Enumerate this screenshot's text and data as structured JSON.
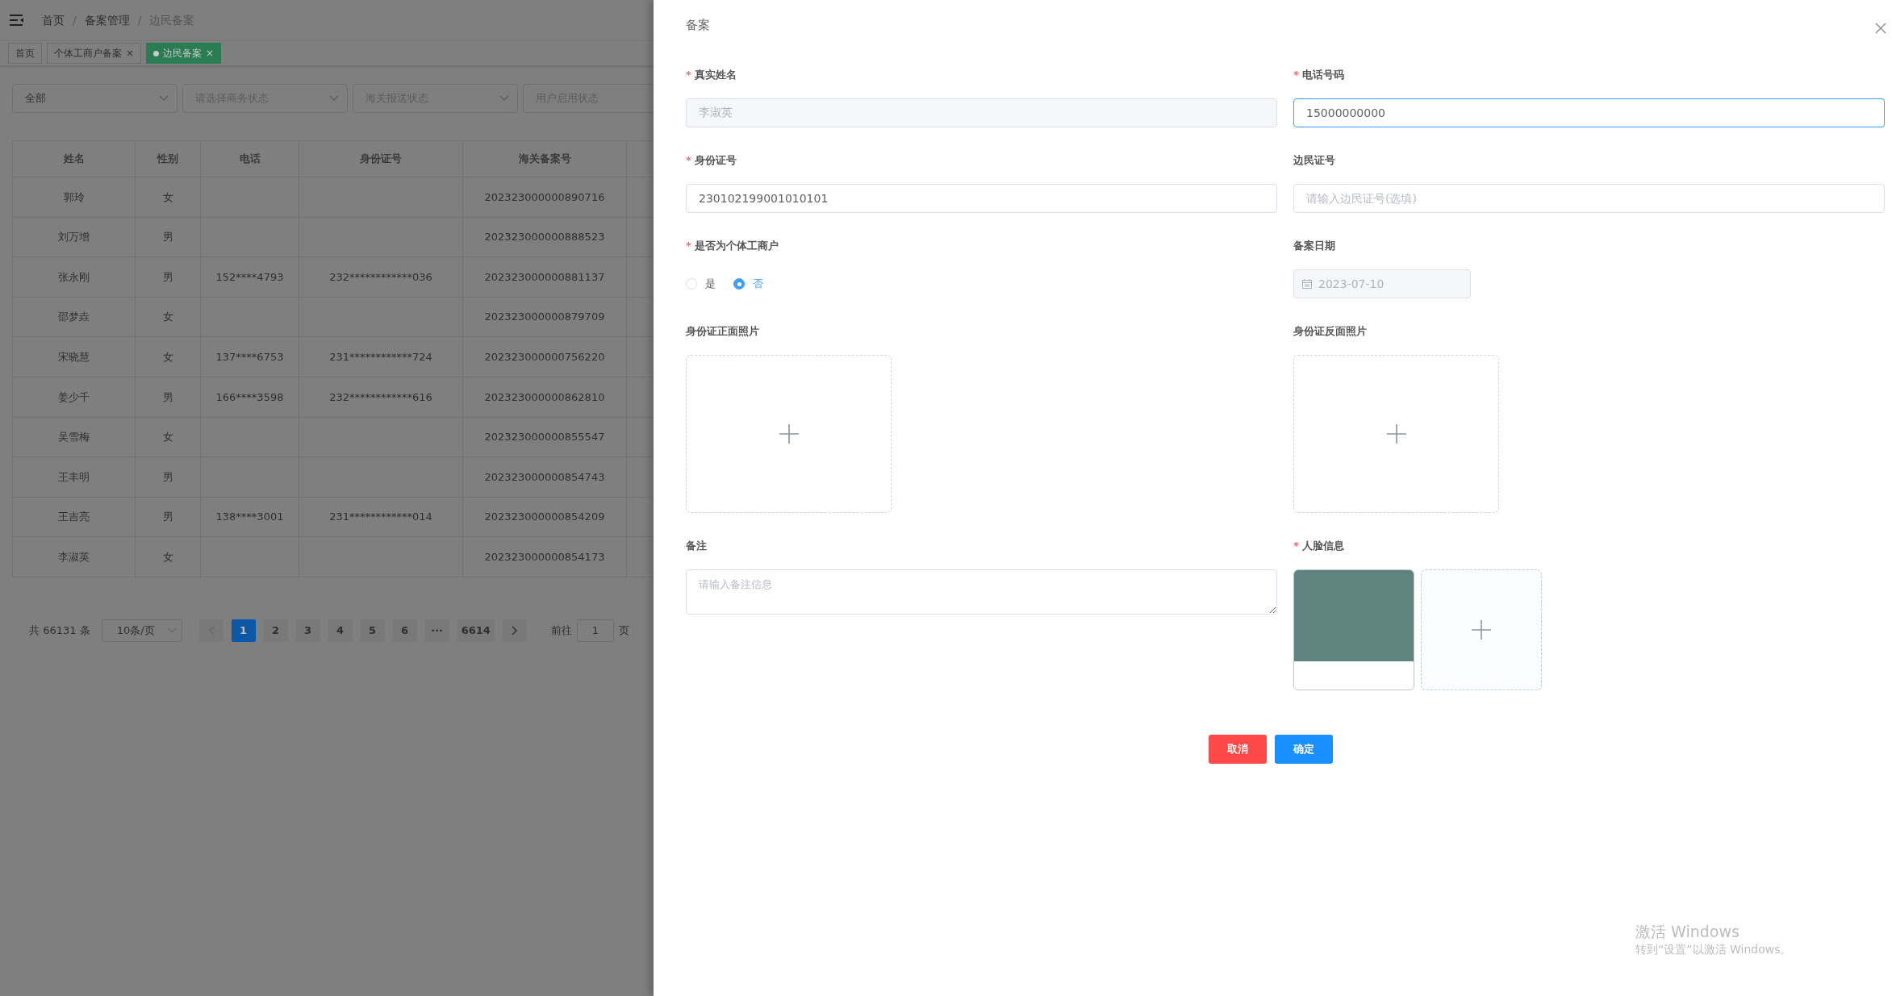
{
  "breadcrumb": [
    {
      "label": "首页",
      "current": false
    },
    {
      "separator": "/",
      "label": "备案管理",
      "current": false
    },
    {
      "separator": "/",
      "label": "边民备案",
      "current": true
    }
  ],
  "tabs": [
    {
      "label": "首页",
      "selected": false
    },
    {
      "label": "个体工商户备案",
      "selected": false,
      "close": "×"
    },
    {
      "label": "边民备案",
      "selected": true,
      "close": "×"
    }
  ],
  "filters": [
    {
      "value": "全部",
      "arrow": true
    },
    {
      "placeholder": "请选择商务状态",
      "arrow": true
    },
    {
      "placeholder": "海关报送状态",
      "arrow": true
    },
    {
      "placeholder": "用户启用状态"
    }
  ],
  "table": {
    "columns": [
      "姓名",
      "性别",
      "电话",
      "身份证号",
      "海关备案号"
    ],
    "rows": [
      {
        "name": "郭玲",
        "gender": "女",
        "customs_no": "202323000000890716"
      },
      {
        "name": "刘万增",
        "gender": "男",
        "customs_no": "202323000000888523"
      },
      {
        "name": "张永刚",
        "gender": "男",
        "phone": "152****4793",
        "id_number": "232************036",
        "customs_no": "202323000000881137"
      },
      {
        "name": "邵梦垚",
        "gender": "女",
        "customs_no": "202323000000879709"
      },
      {
        "name": "宋晓慧",
        "gender": "女",
        "phone": "137****6753",
        "id_number": "231************724",
        "customs_no": "202323000000756220"
      },
      {
        "name": "姜少千",
        "gender": "男",
        "phone": "166****3598",
        "id_number": "232************616",
        "customs_no": "202323000000862810"
      },
      {
        "name": "吴雪梅",
        "gender": "女",
        "customs_no": "202323000000855547"
      },
      {
        "name": "王丰明",
        "gender": "男",
        "customs_no": "202323000000854743"
      },
      {
        "name": "王吉亮",
        "gender": "男",
        "phone": "138****3001",
        "id_number": "231************014",
        "customs_no": "202323000000854209"
      },
      {
        "name": "李淑英",
        "gender": "女",
        "customs_no": "202323000000854173"
      }
    ]
  },
  "pagination": {
    "total": "共 66131 条",
    "page_size": "10条/页",
    "pages": [
      {
        "label": "1",
        "selected": true
      },
      {
        "label": "2",
        "selected": false
      },
      {
        "label": "3",
        "selected": false
      },
      {
        "label": "4",
        "selected": false
      },
      {
        "label": "5",
        "selected": false
      },
      {
        "label": "6",
        "selected": false
      },
      {
        "label": "···",
        "selected": false
      },
      {
        "label": "6614",
        "selected": false
      }
    ],
    "goto_label": "前往",
    "goto_value": "1",
    "goto_suffix": "页"
  },
  "drawer": {
    "title": "备案",
    "fields": [
      {
        "kind": "input",
        "required_mark": "*",
        "label": "真实姓名",
        "value": "李淑英",
        "disabled": true
      },
      {
        "kind": "input",
        "required_mark": "*",
        "label": "电话号码",
        "value": "15000000000",
        "focused": true
      },
      {
        "kind": "input",
        "required_mark": "*",
        "label": "身份证号",
        "value": "230102199001010101"
      },
      {
        "kind": "input",
        "label": "边民证号",
        "placeholder": "请输入边民证号(选填)"
      },
      {
        "kind": "radio",
        "required_mark": "*",
        "label": "是否为个体工商户",
        "options": [
          {
            "label": "是",
            "selected": false
          },
          {
            "label": "否",
            "selected": true
          }
        ]
      },
      {
        "kind": "date",
        "label": "备案日期",
        "value": "2023-07-10",
        "disabled": true
      },
      {
        "kind": "upload",
        "label": "身份证正面照片"
      },
      {
        "kind": "upload",
        "label": "身份证反面照片"
      },
      {
        "kind": "textarea",
        "label": "备注",
        "placeholder": "请输入备注信息"
      },
      {
        "kind": "images",
        "required_mark": "*",
        "label": "人脸信息",
        "items": [
          {
            "kind": "photo"
          },
          {
            "kind": "add"
          }
        ]
      }
    ],
    "buttons": [
      {
        "label": "取消",
        "kind": "danger"
      },
      {
        "label": "确定",
        "kind": "primary"
      }
    ]
  },
  "os_notice": {
    "title": "激活 Windows",
    "text": "转到“设置”以激活 Windows。"
  }
}
